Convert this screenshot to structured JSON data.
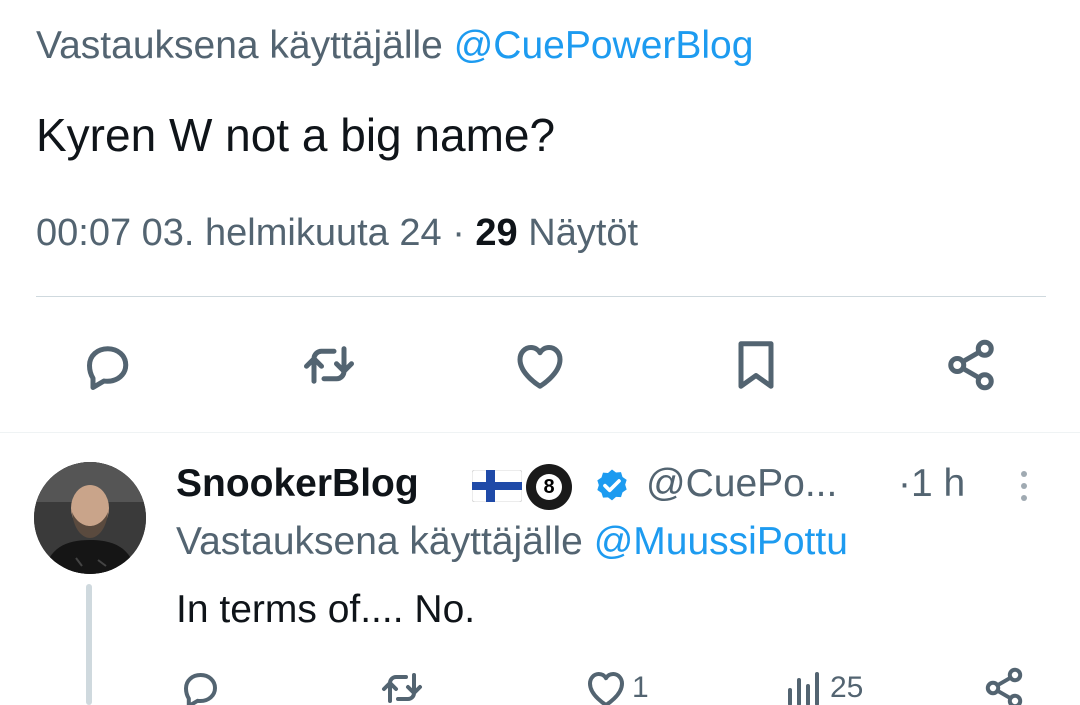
{
  "main_tweet": {
    "reply_prefix": "Vastauksena käyttäjälle",
    "reply_mention": "@CuePowerBlog",
    "text": "Kyren W not a big name?",
    "timestamp": "00:07 03. helmikuuta 24",
    "separator": "·",
    "views_count": "29",
    "views_label": "Näytöt"
  },
  "actions": {
    "reply_icon": "reply-icon",
    "retweet_icon": "retweet-icon",
    "like_icon": "like-icon",
    "bookmark_icon": "bookmark-icon",
    "share_icon": "share-icon"
  },
  "reply": {
    "author": "SnookerBlog",
    "flag": "finland-flag",
    "ball_number": "8",
    "verified": "verified-icon",
    "handle": "@CuePo...",
    "time": "·1 h",
    "reply_prefix": "Vastauksena käyttäjälle",
    "reply_mention": "@MuussiPottu",
    "text": "In terms of.... No.",
    "like_count": "1",
    "views_count": "25"
  },
  "colors": {
    "text": "#0f1419",
    "secondary": "#536471",
    "accent": "#1d9bf0",
    "divider": "#cfd9de"
  }
}
